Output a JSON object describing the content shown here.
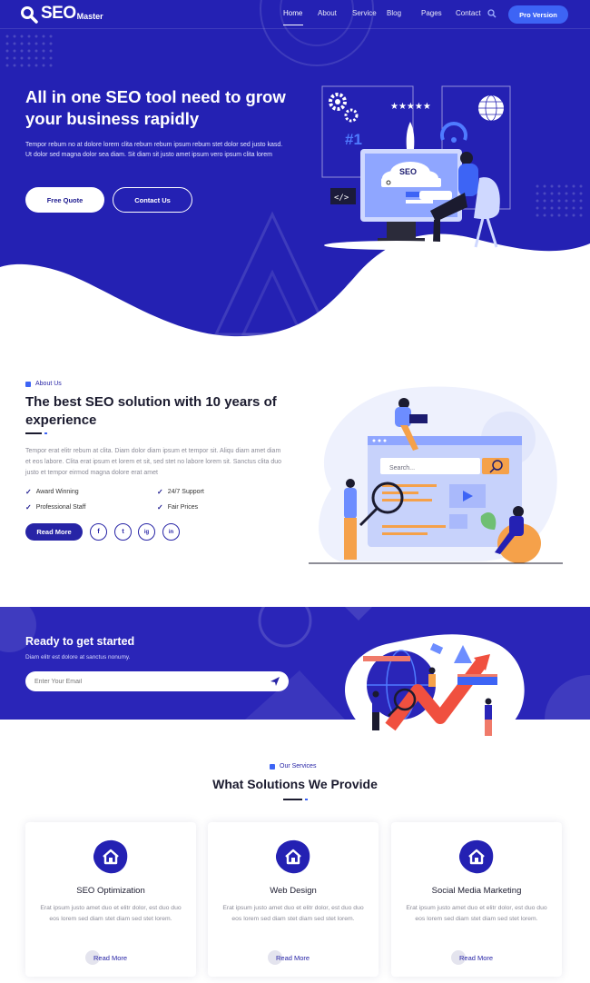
{
  "colors": {
    "primary": "#2724a6",
    "accent": "#3d64f5",
    "dark": "#1b1b2f"
  },
  "nav": {
    "logo_main": "SEO",
    "logo_sub": "Master",
    "links": [
      "Home",
      "About",
      "Service",
      "Blog",
      "Pages",
      "Contact"
    ],
    "active_index": 0,
    "pro_button": "Pro Version"
  },
  "hero": {
    "title": "All in one SEO tool need to grow your business rapidly",
    "text": "Tempor rebum no at dolore lorem clita rebum rebum ipsum rebum stet dolor sed justo kasd. Ut dolor sed magna dolor sea diam. Sit diam sit justo amet ipsum vero ipsum clita lorem",
    "btn_primary": "Free Quote",
    "btn_secondary": "Contact Us",
    "illustration": {
      "badge": "#1",
      "screen_label": "SEO",
      "code_icon": "</>"
    }
  },
  "about": {
    "tag": "About Us",
    "title": "The best SEO solution with 10 years of experience",
    "text": "Tempor erat elitr rebum at clita. Diam dolor diam ipsum et tempor sit. Aliqu diam amet diam et eos labore. Clita erat ipsum et lorem et sit, sed stet no labore lorem sit. Sanctus clita duo justo et tempor eirmod magna dolore erat amet",
    "features": [
      "Award Winning",
      "24/7 Support",
      "Professional Staff",
      "Fair Prices"
    ],
    "read_more": "Read More",
    "social": [
      "f",
      "t",
      "ig",
      "in"
    ],
    "illustration": {
      "search_placeholder": "Search..."
    }
  },
  "cta": {
    "title": "Ready to get started",
    "subtitle": "Diam elitr est dolore at sanctus nonumy.",
    "email_placeholder": "Enter Your Email"
  },
  "services": {
    "tag": "Our Services",
    "title": "What Solutions We Provide",
    "cards": [
      {
        "title": "SEO Optimization",
        "text": "Erat ipsum justo amet duo et elitr dolor, est duo duo eos lorem sed diam stet diam sed stet lorem.",
        "link": "Read More",
        "icon": "home-icon"
      },
      {
        "title": "Web Design",
        "text": "Erat ipsum justo amet duo et elitr dolor, est duo duo eos lorem sed diam stet diam sed stet lorem.",
        "link": "Read More",
        "icon": "home-icon"
      },
      {
        "title": "Social Media Marketing",
        "text": "Erat ipsum justo amet duo et elitr dolor, est duo duo eos lorem sed diam stet diam sed stet lorem.",
        "link": "Read More",
        "icon": "home-icon"
      }
    ]
  }
}
